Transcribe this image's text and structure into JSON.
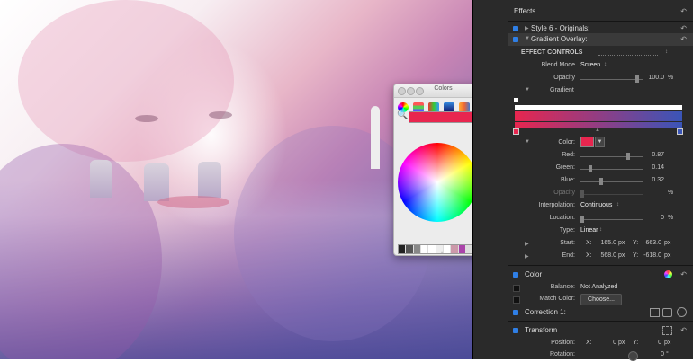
{
  "colors_panel": {
    "title": "Colors",
    "current_color": "#e8264f",
    "mode_icons": [
      "color-wheel-icon",
      "color-sliders-icon",
      "color-palettes-icon",
      "image-palettes-icon",
      "crayons-icon"
    ]
  },
  "inspector": {
    "effects_label": "Effects",
    "style_item": "Style 6 - Originals:",
    "gradient_item": "Gradient Overlay:",
    "effect_controls": "EFFECT CONTROLS",
    "blend_mode": {
      "label": "Blend Mode",
      "value": "Screen"
    },
    "opacity": {
      "label": "Opacity",
      "value": "100.0",
      "unit": "%"
    },
    "gradient_label": "Gradient",
    "color_label": "Color:",
    "color_swatch": "#e8264f",
    "red": {
      "label": "Red:",
      "value": "0.87"
    },
    "green": {
      "label": "Green:",
      "value": "0.14"
    },
    "blue": {
      "label": "Blue:",
      "value": "0.32"
    },
    "opacity2": {
      "label": "Opacity",
      "unit": "%"
    },
    "interpolation": {
      "label": "Interpolation:",
      "value": "Continuous"
    },
    "location": {
      "label": "Location:",
      "value": "0",
      "unit": "%"
    },
    "type": {
      "label": "Type:",
      "value": "Linear"
    },
    "start": {
      "label": "Start:",
      "x_label": "X:",
      "x": "165.0",
      "x_unit": "px",
      "y_label": "Y:",
      "y": "663.0",
      "y_unit": "px"
    },
    "end": {
      "label": "End:",
      "x_label": "X:",
      "x": "568.0",
      "x_unit": "px",
      "y_label": "Y:",
      "y": "-618.0",
      "y_unit": "px"
    },
    "color_section": "Color",
    "balance": {
      "label": "Balance:",
      "value": "Not Analyzed"
    },
    "match_color": {
      "label": "Match Color:",
      "button": "Choose..."
    },
    "correction": "Correction 1:",
    "transform_section": "Transform",
    "position": {
      "label": "Position:",
      "x_label": "X:",
      "x": "0",
      "x_unit": "px",
      "y_label": "Y:",
      "y": "0",
      "y_unit": "px"
    },
    "rotation": {
      "label": "Rotation:",
      "value": "0",
      "unit": "°"
    }
  }
}
